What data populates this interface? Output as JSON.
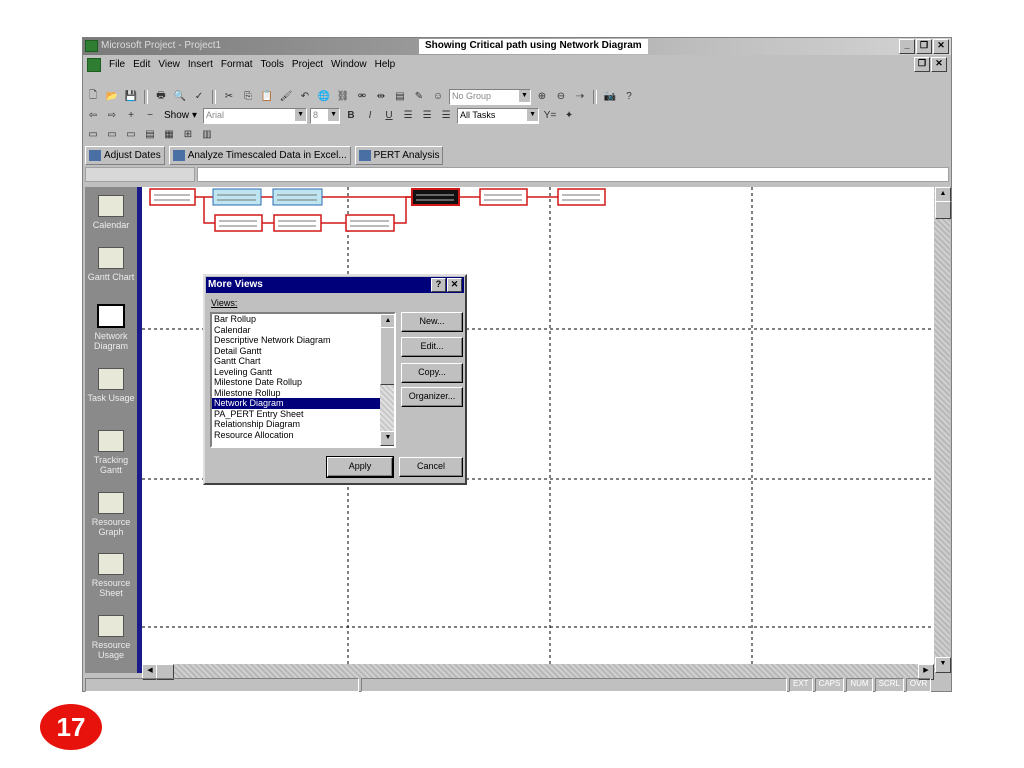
{
  "window": {
    "app_title": "Microsoft Project - Project1",
    "annotation": "Showing Critical path using Network Diagram"
  },
  "menu": [
    "File",
    "Edit",
    "View",
    "Insert",
    "Format",
    "Tools",
    "Project",
    "Window",
    "Help"
  ],
  "toolbar": {
    "group_combo": "No Group",
    "show_label": "Show",
    "font_combo": "Arial",
    "size_combo": "8",
    "filter_combo": "All Tasks"
  },
  "custom_buttons": [
    "Adjust Dates",
    "Analyze Timescaled Data in Excel...",
    "PERT Analysis"
  ],
  "view_bar": [
    {
      "label": "Calendar"
    },
    {
      "label": "Gantt Chart"
    },
    {
      "label": "Network Diagram",
      "active": true
    },
    {
      "label": "Task Usage"
    },
    {
      "label": "Tracking Gantt"
    },
    {
      "label": "Resource Graph"
    },
    {
      "label": "Resource Sheet"
    },
    {
      "label": "Resource Usage"
    }
  ],
  "dialog": {
    "title": "More Views",
    "views_label": "Views:",
    "items": [
      "Bar Rollup",
      "Calendar",
      "Descriptive Network Diagram",
      "Detail Gantt",
      "Gantt Chart",
      "Leveling Gantt",
      "Milestone Date Rollup",
      "Milestone Rollup",
      "Network Diagram",
      "PA_PERT Entry Sheet",
      "Relationship Diagram",
      "Resource Allocation"
    ],
    "selected_index": 8,
    "buttons": {
      "new": "New...",
      "edit": "Edit...",
      "copy": "Copy...",
      "organizer": "Organizer...",
      "apply": "Apply",
      "cancel": "Cancel"
    }
  },
  "status_panels": [
    "EXT",
    "CAPS",
    "NUM",
    "SCRL",
    "OVR"
  ],
  "slide_number": "17",
  "colors": {
    "critical": "#d01818",
    "noncritical_fill": "#bfe6f0",
    "selected_node": "#111111",
    "title_blue": "#00007b"
  }
}
